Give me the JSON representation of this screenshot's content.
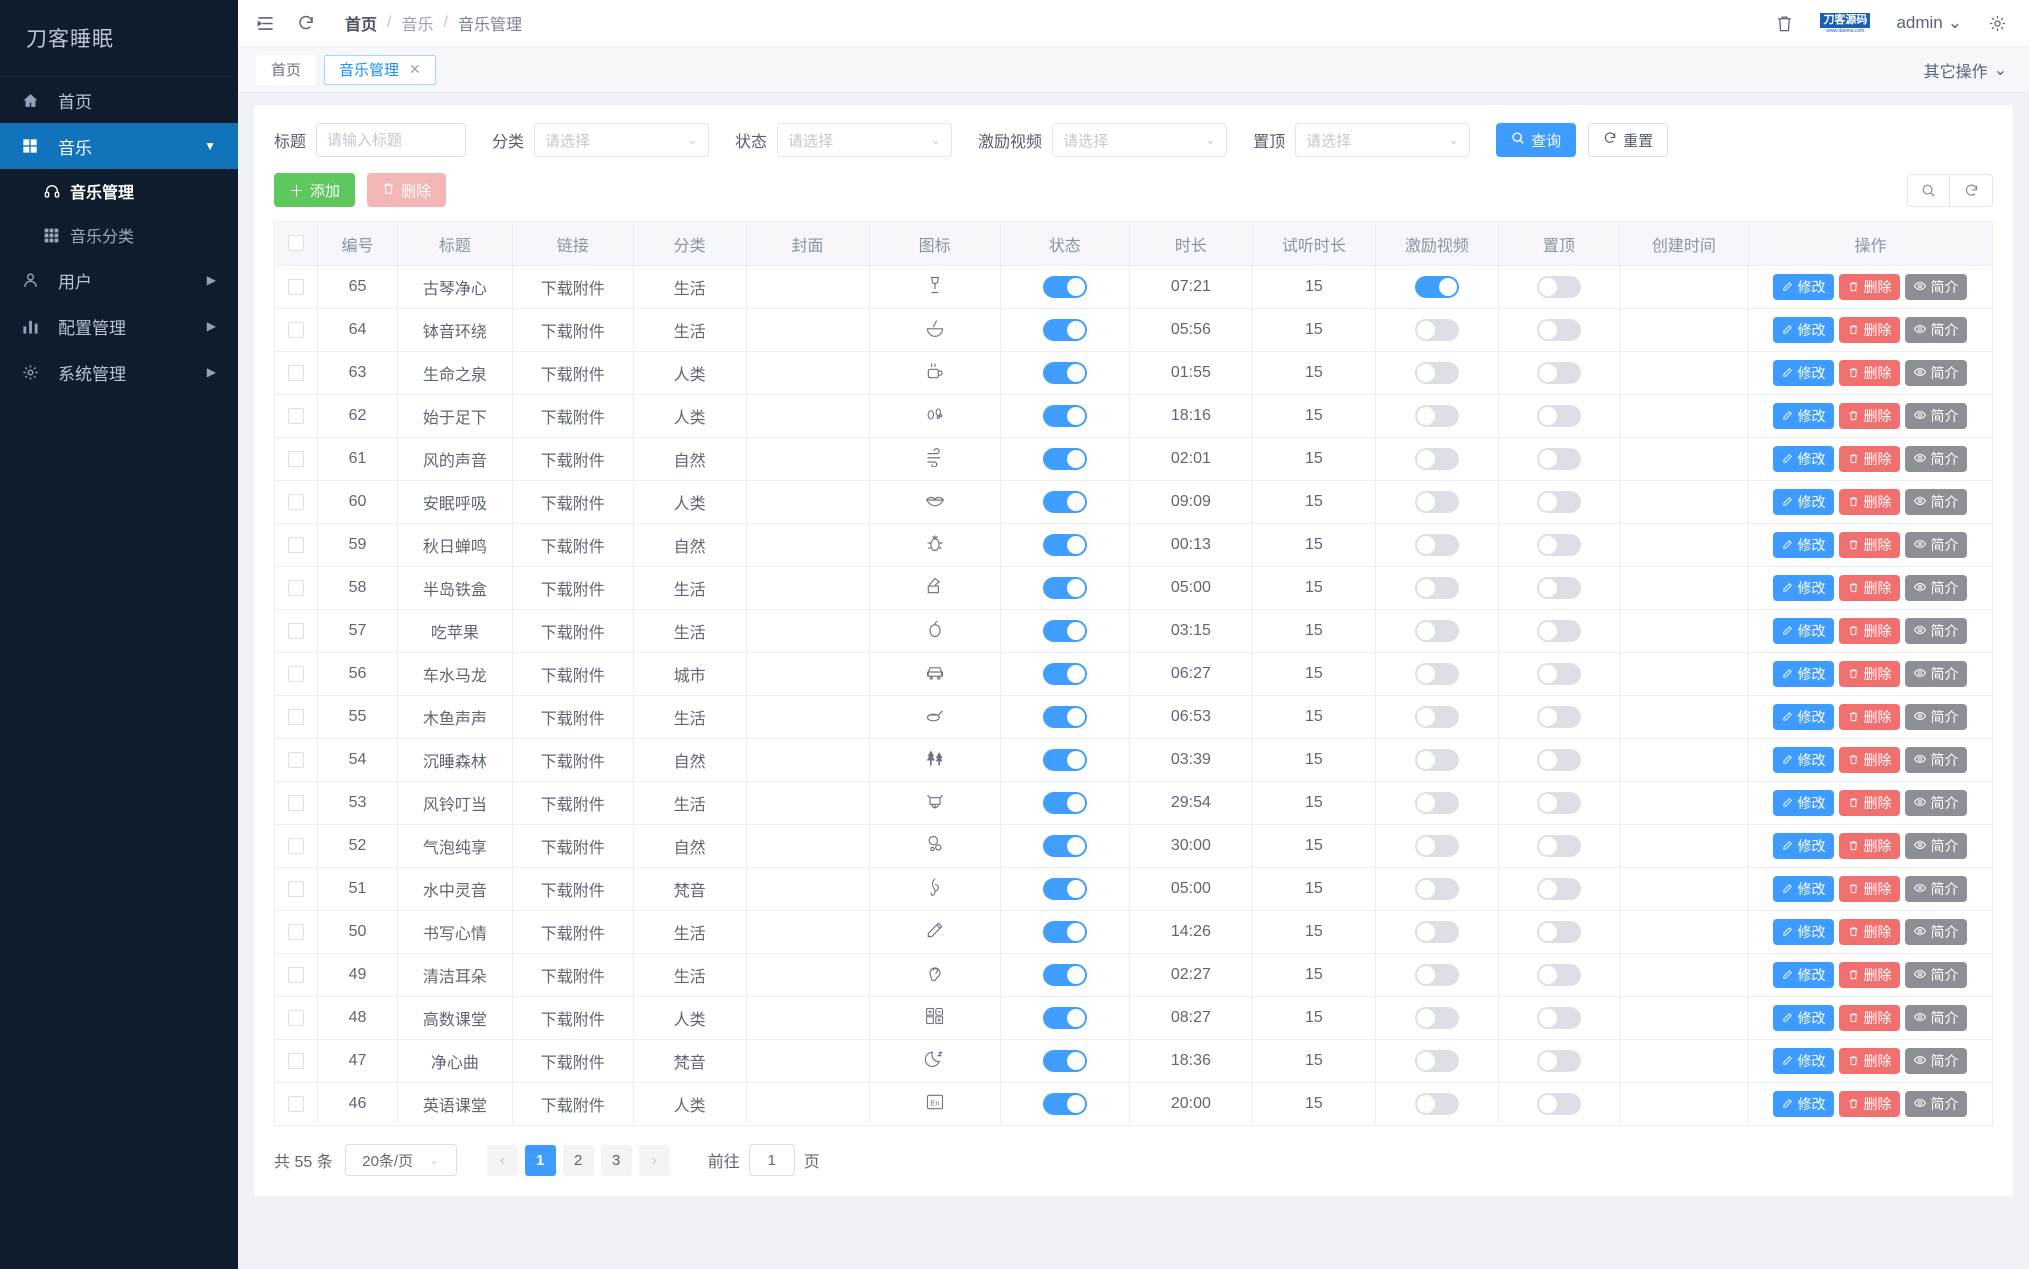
{
  "sidebar": {
    "logo": "刀客睡眠",
    "items": [
      {
        "label": "首页",
        "icon": "home-icon",
        "arrow": ""
      },
      {
        "label": "音乐",
        "icon": "grid-icon",
        "arrow": "▼"
      },
      {
        "label": "用户",
        "icon": "user-icon",
        "arrow": "▶"
      },
      {
        "label": "配置管理",
        "icon": "chart-icon",
        "arrow": "▶"
      },
      {
        "label": "系统管理",
        "icon": "gear-icon",
        "arrow": "▶"
      }
    ],
    "submenu": [
      {
        "label": "音乐管理",
        "icon": "headphone-icon"
      },
      {
        "label": "音乐分类",
        "icon": "grid-small-icon"
      }
    ]
  },
  "topbar": {
    "menu_icon": "hamburger-icon",
    "refresh_icon": "refresh-icon",
    "breadcrumb": [
      "首页",
      "音乐",
      "音乐管理"
    ],
    "separator": "/",
    "trash_icon": "trash-icon",
    "brand_line1": "刀客源码",
    "brand_line2": "www.daoma.com",
    "admin": "admin",
    "admin_caret": "⌄",
    "settings_icon": "gear-icon"
  },
  "tabbar": {
    "tabs": [
      {
        "label": "首页",
        "closable": false,
        "active": false
      },
      {
        "label": "音乐管理",
        "closable": true,
        "active": true
      }
    ],
    "close_glyph": "✕",
    "other_actions": "其它操作",
    "other_caret": "⌄"
  },
  "filters": [
    {
      "label": "标题",
      "type": "input",
      "placeholder": "请输入标题",
      "value": ""
    },
    {
      "label": "分类",
      "type": "select",
      "placeholder": "请选择",
      "value": ""
    },
    {
      "label": "状态",
      "type": "select",
      "placeholder": "请选择",
      "value": ""
    },
    {
      "label": "激励视频",
      "type": "select",
      "placeholder": "请选择",
      "value": ""
    },
    {
      "label": "置顶",
      "type": "select",
      "placeholder": "请选择",
      "value": ""
    }
  ],
  "filter_buttons": {
    "search": "查询",
    "search_icon": "search-icon",
    "reset": "重置",
    "reset_icon": "refresh-icon"
  },
  "toolbar": {
    "add": "添加",
    "add_icon": "plus-icon",
    "delete": "删除",
    "delete_icon": "trash-icon",
    "search_icon": "search-icon",
    "refresh_icon": "refresh-icon"
  },
  "table": {
    "columns": [
      "编号",
      "标题",
      "链接",
      "分类",
      "封面",
      "图标",
      "状态",
      "时长",
      "试听时长",
      "激励视频",
      "置顶",
      "创建时间",
      "操作"
    ],
    "link_text": "下载附件",
    "actions": {
      "edit": "修改",
      "edit_icon": "pencil-icon",
      "delete": "删除",
      "delete_icon": "trash-icon",
      "info": "简介",
      "info_icon": "eye-icon"
    },
    "rows": [
      {
        "id": "65",
        "title": "古琴净心",
        "link": "下载附件",
        "category": "生活",
        "cover": "",
        "icon": "🎼",
        "glyph": "⚱",
        "status": true,
        "duration": "07:21",
        "trial": "15",
        "reward": true,
        "top": false,
        "created": ""
      },
      {
        "id": "64",
        "title": "钵音环绕",
        "link": "下载附件",
        "category": "生活",
        "cover": "",
        "icon": "bowl-icon",
        "glyph": "🥣",
        "status": true,
        "duration": "05:56",
        "trial": "15",
        "reward": false,
        "top": false,
        "created": ""
      },
      {
        "id": "63",
        "title": "生命之泉",
        "link": "下载附件",
        "category": "人类",
        "cover": "",
        "icon": "cup-icon",
        "glyph": "☕",
        "status": true,
        "duration": "01:55",
        "trial": "15",
        "reward": false,
        "top": false,
        "created": ""
      },
      {
        "id": "62",
        "title": "始于足下",
        "link": "下载附件",
        "category": "人类",
        "cover": "",
        "icon": "footprints-icon",
        "glyph": "👣",
        "status": true,
        "duration": "18:16",
        "trial": "15",
        "reward": false,
        "top": false,
        "created": ""
      },
      {
        "id": "61",
        "title": "风的声音",
        "link": "下载附件",
        "category": "自然",
        "cover": "",
        "icon": "wind-icon",
        "glyph": "🌬",
        "status": true,
        "duration": "02:01",
        "trial": "15",
        "reward": false,
        "top": false,
        "created": ""
      },
      {
        "id": "60",
        "title": "安眠呼吸",
        "link": "下载附件",
        "category": "人类",
        "cover": "",
        "icon": "lips-icon",
        "glyph": "👄",
        "status": true,
        "duration": "09:09",
        "trial": "15",
        "reward": false,
        "top": false,
        "created": ""
      },
      {
        "id": "59",
        "title": "秋日蝉鸣",
        "link": "下载附件",
        "category": "自然",
        "cover": "",
        "icon": "bug-icon",
        "glyph": "🪲",
        "status": true,
        "duration": "00:13",
        "trial": "15",
        "reward": false,
        "top": false,
        "created": ""
      },
      {
        "id": "58",
        "title": "半岛铁盒",
        "link": "下载附件",
        "category": "生活",
        "cover": "",
        "icon": "box-icon",
        "glyph": "📦",
        "status": true,
        "duration": "05:00",
        "trial": "15",
        "reward": false,
        "top": false,
        "created": ""
      },
      {
        "id": "57",
        "title": "吃苹果",
        "link": "下载附件",
        "category": "生活",
        "cover": "",
        "icon": "apple-icon",
        "glyph": "🍎",
        "status": true,
        "duration": "03:15",
        "trial": "15",
        "reward": false,
        "top": false,
        "created": ""
      },
      {
        "id": "56",
        "title": "车水马龙",
        "link": "下载附件",
        "category": "城市",
        "cover": "",
        "icon": "car-icon",
        "glyph": "🚗",
        "status": true,
        "duration": "06:27",
        "trial": "15",
        "reward": false,
        "top": false,
        "created": ""
      },
      {
        "id": "55",
        "title": "木鱼声声",
        "link": "下载附件",
        "category": "生活",
        "cover": "",
        "icon": "woodfish-icon",
        "glyph": "🪘",
        "status": true,
        "duration": "06:53",
        "trial": "15",
        "reward": false,
        "top": false,
        "created": ""
      },
      {
        "id": "54",
        "title": "沉睡森林",
        "link": "下载附件",
        "category": "自然",
        "cover": "",
        "icon": "forest-icon",
        "glyph": "🌲",
        "status": true,
        "duration": "03:39",
        "trial": "15",
        "reward": false,
        "top": false,
        "created": ""
      },
      {
        "id": "53",
        "title": "风铃叮当",
        "link": "下载附件",
        "category": "生活",
        "cover": "",
        "icon": "bell-icon",
        "glyph": "🔔",
        "status": true,
        "duration": "29:54",
        "trial": "15",
        "reward": false,
        "top": false,
        "created": ""
      },
      {
        "id": "52",
        "title": "气泡纯享",
        "link": "下载附件",
        "category": "自然",
        "cover": "",
        "icon": "bubbles-icon",
        "glyph": "🫧",
        "status": true,
        "duration": "30:00",
        "trial": "15",
        "reward": false,
        "top": false,
        "created": ""
      },
      {
        "id": "51",
        "title": "水中灵音",
        "link": "下载附件",
        "category": "梵音",
        "cover": "",
        "icon": "clef-icon",
        "glyph": "🎼",
        "status": true,
        "duration": "05:00",
        "trial": "15",
        "reward": false,
        "top": false,
        "created": ""
      },
      {
        "id": "50",
        "title": "书写心情",
        "link": "下载附件",
        "category": "生活",
        "cover": "",
        "icon": "pencil-icon",
        "glyph": "📝",
        "status": true,
        "duration": "14:26",
        "trial": "15",
        "reward": false,
        "top": false,
        "created": ""
      },
      {
        "id": "49",
        "title": "清洁耳朵",
        "link": "下载附件",
        "category": "生活",
        "cover": "",
        "icon": "ear-icon",
        "glyph": "👂",
        "status": true,
        "duration": "02:27",
        "trial": "15",
        "reward": false,
        "top": false,
        "created": ""
      },
      {
        "id": "48",
        "title": "高数课堂",
        "link": "下载附件",
        "category": "人类",
        "cover": "",
        "icon": "calculator-icon",
        "glyph": "🧮",
        "status": true,
        "duration": "08:27",
        "trial": "15",
        "reward": false,
        "top": false,
        "created": ""
      },
      {
        "id": "47",
        "title": "净心曲",
        "link": "下载附件",
        "category": "梵音",
        "cover": "",
        "icon": "moon-icon",
        "glyph": "🌙",
        "status": true,
        "duration": "18:36",
        "trial": "15",
        "reward": false,
        "top": false,
        "created": ""
      },
      {
        "id": "46",
        "title": "英语课堂",
        "link": "下载附件",
        "category": "人类",
        "cover": "",
        "icon": "english-icon",
        "glyph": "🔤",
        "status": true,
        "duration": "20:00",
        "trial": "15",
        "reward": false,
        "top": false,
        "created": ""
      }
    ]
  },
  "pagination": {
    "total_text": "共 55 条",
    "page_size": "20条/页",
    "prev": "‹",
    "next": "›",
    "pages": [
      "1",
      "2",
      "3"
    ],
    "current_page": "1",
    "goto_label": "前往",
    "goto_value": "1",
    "page_unit": "页"
  },
  "colors": {
    "sidebar_bg": "#0f1c2e",
    "sidebar_active": "#1174bb",
    "primary": "#3e9bff",
    "green": "#5ec75e",
    "red": "#f07070",
    "gray": "#8c8f96",
    "switch_on": "#409eff"
  }
}
